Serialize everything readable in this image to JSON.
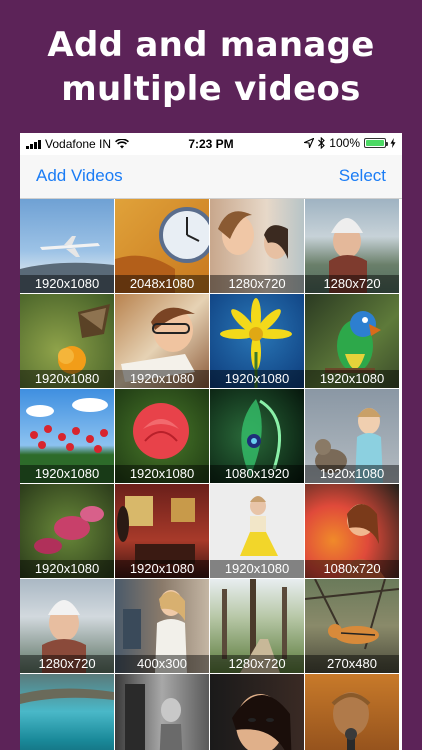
{
  "promo": {
    "line1": "Add and manage",
    "line2": "multiple videos"
  },
  "status_bar": {
    "carrier": "Vodafone IN",
    "time": "7:23 PM",
    "battery": "100%"
  },
  "nav": {
    "left_button": "Add Videos",
    "right_button": "Select"
  },
  "videos": [
    {
      "resolution": "1920x1080",
      "subject": "airplane"
    },
    {
      "resolution": "2048x1080",
      "subject": "clock"
    },
    {
      "resolution": "1280x720",
      "subject": "laughing-women"
    },
    {
      "resolution": "1280x720",
      "subject": "woman-beanie-lake"
    },
    {
      "resolution": "1920x1080",
      "subject": "butterfly"
    },
    {
      "resolution": "1920x1080",
      "subject": "boy-studying"
    },
    {
      "resolution": "1920x1080",
      "subject": "yellow-flower"
    },
    {
      "resolution": "1920x1080",
      "subject": "parrot"
    },
    {
      "resolution": "1920x1080",
      "subject": "red-flowers-sky"
    },
    {
      "resolution": "1920x1080",
      "subject": "red-rose"
    },
    {
      "resolution": "1080x1920",
      "subject": "green-feathers"
    },
    {
      "resolution": "1920x1080",
      "subject": "girl-and-cat"
    },
    {
      "resolution": "1920x1080",
      "subject": "pink-flowers"
    },
    {
      "resolution": "1920x1080",
      "subject": "red-room"
    },
    {
      "resolution": "1920x1080",
      "subject": "girl-yellow-dress"
    },
    {
      "resolution": "1080x720",
      "subject": "woman-smoke"
    },
    {
      "resolution": "1280x720",
      "subject": "woman-beanie"
    },
    {
      "resolution": "400x300",
      "subject": "woman-cafe"
    },
    {
      "resolution": "1280x720",
      "subject": "park-path"
    },
    {
      "resolution": "270x480",
      "subject": "tiger"
    },
    {
      "resolution": "",
      "subject": "coastline"
    },
    {
      "resolution": "",
      "subject": "bw-street"
    },
    {
      "resolution": "",
      "subject": "woman-portrait"
    },
    {
      "resolution": "",
      "subject": "monk-microphone"
    }
  ]
}
